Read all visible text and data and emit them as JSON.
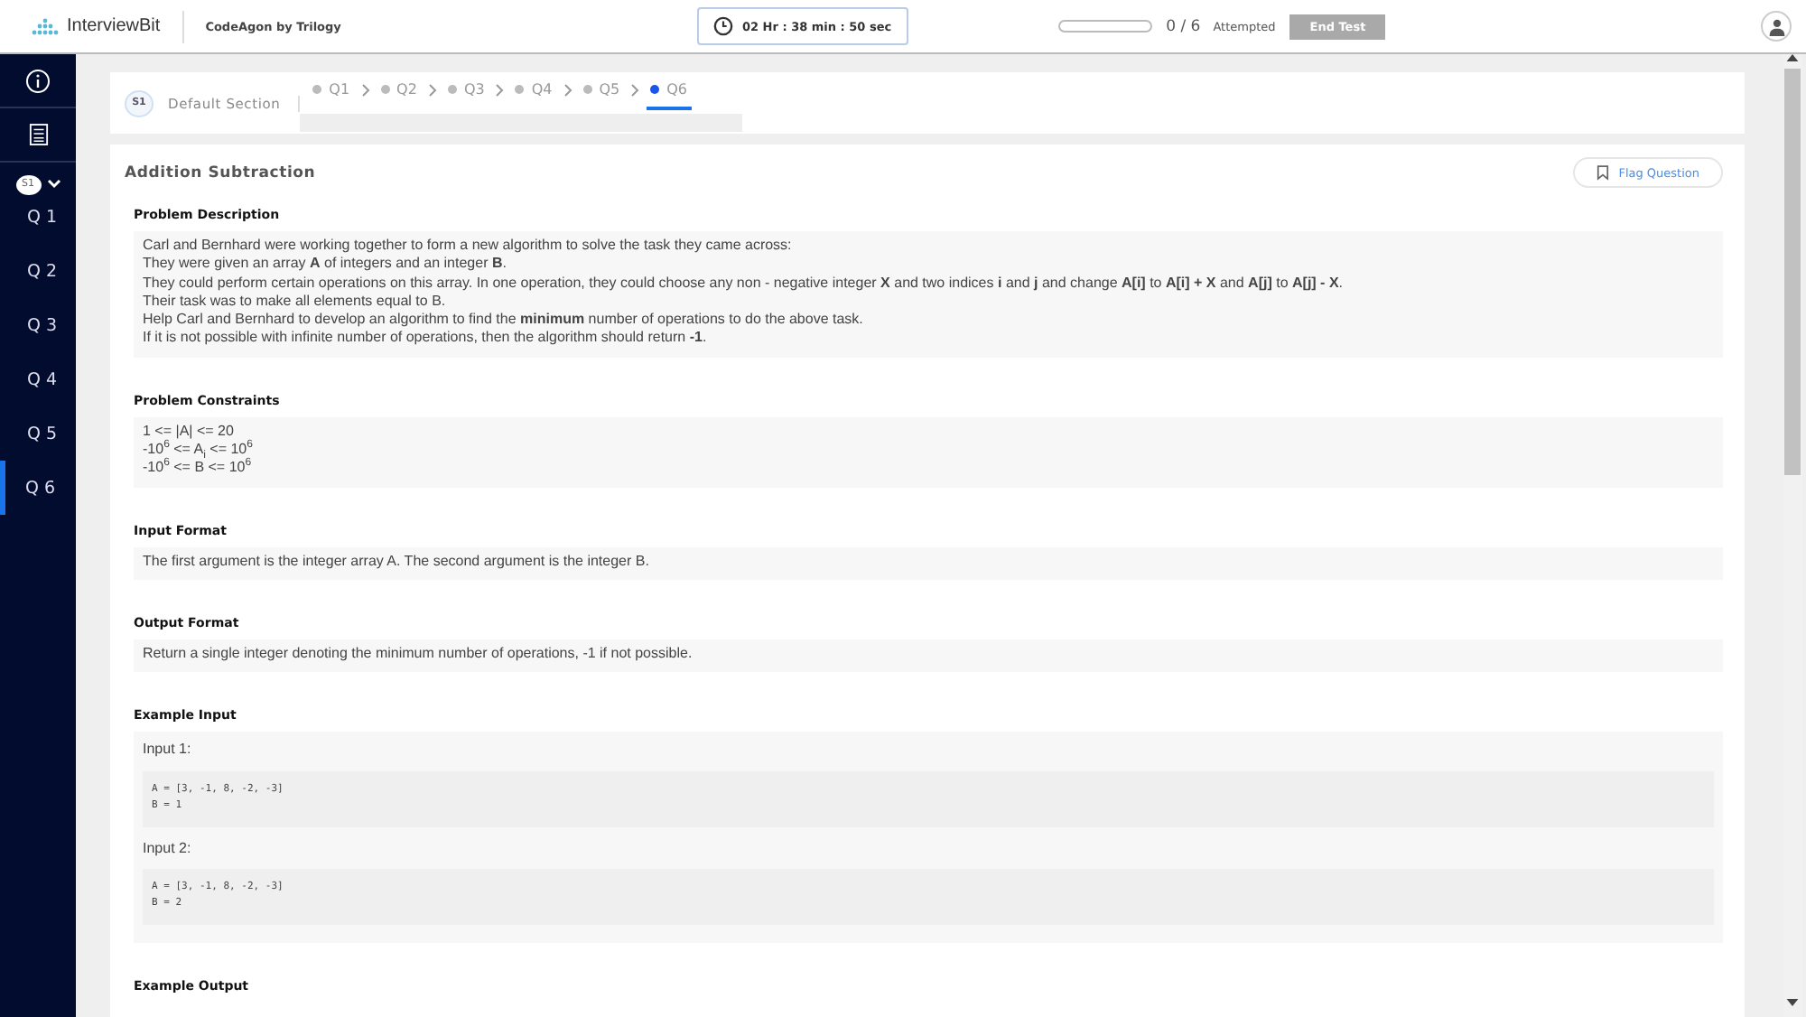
{
  "header": {
    "logo": "InterviewBit",
    "subtitle": "CodeAgon by Trilogy",
    "timer": "02 Hr : 38 min : 50 sec",
    "progress": {
      "level": 0
    },
    "count": "0 / 6",
    "attempted": "Attempted",
    "end_button": {
      "label": "End Test",
      "disabled": true
    }
  },
  "sidebar": {
    "section_badge": "S1",
    "items": [
      {
        "label": "Q 1",
        "selected": false
      },
      {
        "label": "Q 2",
        "selected": false
      },
      {
        "label": "Q 3",
        "selected": false
      },
      {
        "label": "Q 4",
        "selected": false
      },
      {
        "label": "Q 5",
        "selected": false
      },
      {
        "label": "Q 6",
        "selected": true
      }
    ]
  },
  "section_bar": {
    "badge": "S1",
    "name": "Default Section",
    "questions": [
      {
        "label": "Q1",
        "selected": false
      },
      {
        "label": "Q2",
        "selected": false
      },
      {
        "label": "Q3",
        "selected": false
      },
      {
        "label": "Q4",
        "selected": false
      },
      {
        "label": "Q5",
        "selected": false
      },
      {
        "label": "Q6",
        "selected": true
      }
    ]
  },
  "problem": {
    "title": "Addition Subtraction",
    "flag_button": "Flag Question",
    "sections": [
      {
        "kind": "text",
        "heading": "Problem Description",
        "lines": [
          "Carl and Bernhard were working together to form a new algorithm to solve the task they came across:",
          "They were given an array **A** of integers and an integer **B**.",
          "They could perform certain operations on this array. In one operation, they could choose any non - negative integer **X** and two indices **i** and **j** and change **A[i]** to **A[i] + X** and **A[j]** to **A[j] - X**.",
          "Their task was to make all elements equal to B.",
          "Help Carl and Bernhard to develop an algorithm to find the **minimum** number of operations to do the above task.",
          "If it is not possible with infinite number of operations, then the algorithm should return **-1**."
        ]
      },
      {
        "kind": "text",
        "heading": "Problem Constraints",
        "lines": [
          "1 <= |A| <= 20",
          "-10$^{6}$ <= A$_{i}$ <= 10$^{6}$",
          "-10$^{6}$ <= B <= 10$^{6}$"
        ]
      },
      {
        "kind": "text",
        "heading": "Input Format",
        "lines": [
          "The first argument is the integer array A. The second argument is the integer B."
        ]
      },
      {
        "kind": "text",
        "heading": "Output Format",
        "lines": [
          "Return a single integer denoting the minimum number of operations, -1 if not possible."
        ]
      },
      {
        "kind": "examples",
        "heading": "Example Input",
        "examples": [
          {
            "label": "Input 1:",
            "code": [
              "A = [3, -1, 8, -2, -3]",
              "B = 1"
            ]
          },
          {
            "label": "Input 2:",
            "code": [
              "A = [3, -1, 8, -2, -3]",
              "B = 2"
            ]
          }
        ]
      },
      {
        "kind": "heading",
        "heading": "Example Output"
      }
    ]
  }
}
